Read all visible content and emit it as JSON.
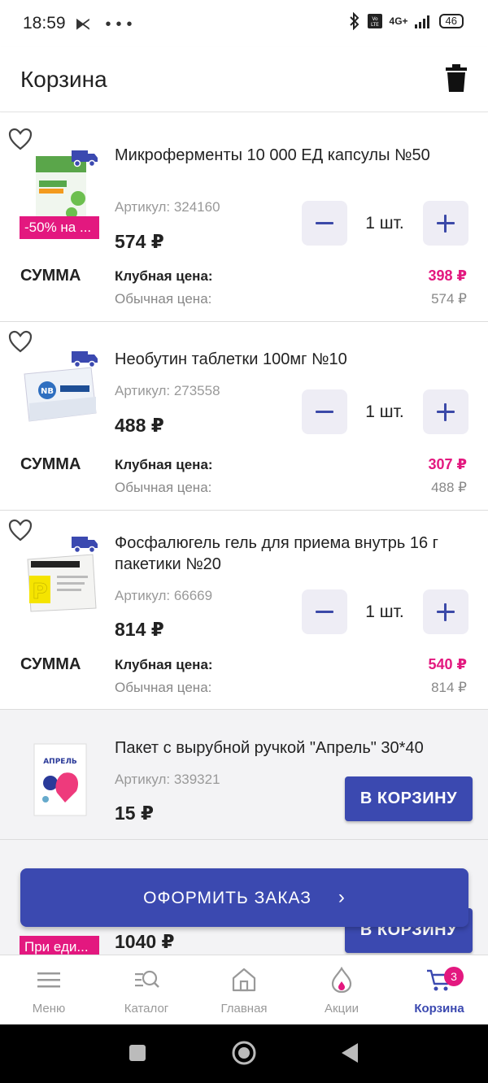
{
  "status_bar": {
    "time": "18:59",
    "left_icons": "⧔ •••",
    "network": "4G+",
    "battery": "46"
  },
  "header": {
    "title": "Корзина",
    "trash_icon": "trash-icon"
  },
  "items": [
    {
      "title": "Микроферменты 10 000 ЕД капсулы №50",
      "sku": "Артикул: 324160",
      "price": "574 ₽",
      "promo": "-50% на ...",
      "qty": "1 шт.",
      "sum_label": "СУММА",
      "club_label": "Клубная цена:",
      "club_price": "398 ₽",
      "regular_label": "Обычная цена:",
      "regular_price": "574 ₽"
    },
    {
      "title": "Необутин таблетки 100мг №10",
      "sku": "Артикул: 273558",
      "price": "488 ₽",
      "qty": "1 шт.",
      "sum_label": "СУММА",
      "club_label": "Клубная цена:",
      "club_price": "307 ₽",
      "regular_label": "Обычная цена:",
      "regular_price": "488 ₽"
    },
    {
      "title": "Фосфалюгель гель для приема внутрь 16 г пакетики №20",
      "sku": "Артикул: 66669",
      "price": "814 ₽",
      "qty": "1 шт.",
      "sum_label": "СУММА",
      "club_label": "Клубная цена:",
      "club_price": "540 ₽",
      "regular_label": "Обычная цена:",
      "regular_price": "814 ₽"
    }
  ],
  "suggestions": [
    {
      "title": "Пакет с вырубной ручкой \"Апрель\" 30*40",
      "sku": "Артикул: 339321",
      "price": "15 ₽",
      "button": "В КОРЗИНУ"
    },
    {
      "price": "1040 ₽",
      "promo": "При еди...",
      "button": "В КОРЗИНУ"
    }
  ],
  "checkout": {
    "label": "ОФОРМИТЬ ЗАКАЗ",
    "arrow": "›"
  },
  "bottom_nav": [
    {
      "label": "Меню",
      "icon": "menu-icon"
    },
    {
      "label": "Каталог",
      "icon": "catalog-search-icon"
    },
    {
      "label": "Главная",
      "icon": "home-icon"
    },
    {
      "label": "Акции",
      "icon": "promo-drop-icon"
    },
    {
      "label": "Корзина",
      "icon": "cart-icon",
      "badge": "3",
      "active": true
    }
  ],
  "colors": {
    "accent": "#3b49b0",
    "pink": "#e3187f",
    "muted": "#999999"
  }
}
